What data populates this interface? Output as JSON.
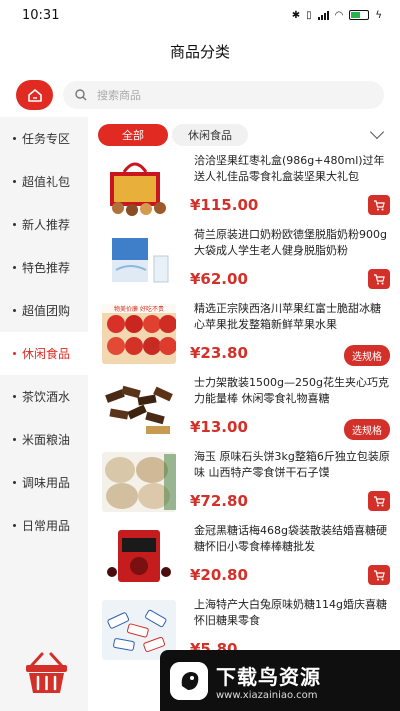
{
  "status_bar": {
    "time": "10:31"
  },
  "header": {
    "title": "商品分类"
  },
  "search": {
    "placeholder": "搜索商品"
  },
  "sidebar": {
    "items": [
      {
        "label": "任务专区"
      },
      {
        "label": "超值礼包"
      },
      {
        "label": "新人推荐"
      },
      {
        "label": "特色推荐"
      },
      {
        "label": "超值团购"
      },
      {
        "label": "休闲食品",
        "active": true
      },
      {
        "label": "茶饮酒水"
      },
      {
        "label": "米面粮油"
      },
      {
        "label": "调味用品"
      },
      {
        "label": "日常用品"
      }
    ]
  },
  "tabs": {
    "all": "全部",
    "current": "休闲食品"
  },
  "products": [
    {
      "name": "洽洽坚果红枣礼盒(986g+480ml)过年送人礼佳品零食礼盒装坚果大礼包",
      "price": "¥115.00",
      "action": "cart"
    },
    {
      "name": "荷兰原装进口奶粉欧德堡脱脂奶粉900g大袋成人学生老人健身脱脂奶粉",
      "price": "¥62.00",
      "action": "cart"
    },
    {
      "name": "精选正宗陕西洛川苹果红富士脆甜冰糖心苹果批发整箱新鲜苹果水果",
      "price": "¥23.80",
      "action": "spec",
      "action_label": "选规格",
      "thumb_text": "物美价廉 好吃不贵"
    },
    {
      "name": "士力架散装1500g—250g花生夹心巧克力能量棒 休闲零食礼物喜糖",
      "price": "¥13.00",
      "action": "spec",
      "action_label": "选规格"
    },
    {
      "name": "海玉 原味石头饼3kg整箱6斤独立包装原味 山西特产零食饼干石子馍",
      "price": "¥72.80",
      "action": "cart"
    },
    {
      "name": "金冠黑糖话梅468g袋装散装结婚喜糖硬糖怀旧小零食棒棒糖批发",
      "price": "¥20.80",
      "action": "cart"
    },
    {
      "name": "上海特产大白兔原味奶糖114g婚庆喜糖怀旧糖果零食",
      "price": "¥5.80",
      "action": "cart"
    }
  ],
  "watermark": {
    "main": "下载鸟资源",
    "url": "www.xiazainiao.com"
  },
  "colors": {
    "accent": "#e02a22",
    "price": "#d3302a"
  }
}
